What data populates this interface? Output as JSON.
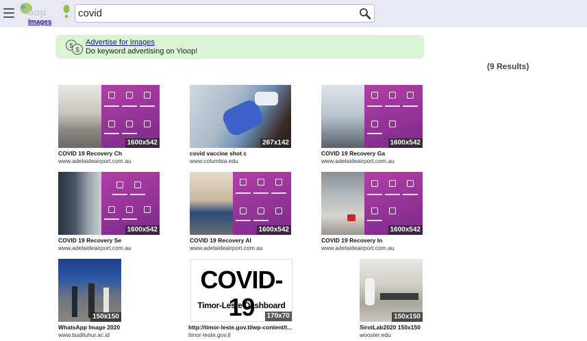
{
  "header": {
    "search_value": "covid",
    "logo_text": "Yioop!",
    "logo_link": "Images"
  },
  "ad": {
    "link": "Advertise for Images",
    "text": "Do keyword advertising on Yioop!"
  },
  "results_count": "(9 Results)",
  "colors": {
    "topbar": "#e9e9f6",
    "ad_bg": "#d9f5d4",
    "link": "#1a0dab",
    "purple": "#9b35a0"
  },
  "results": [
    {
      "title": "COVID 19 Recovery Ch",
      "domain": "www.adelaideairport.com.au",
      "size": "1600x542"
    },
    {
      "title": "covid vaccine shot c",
      "domain": "www.columbia.edu",
      "size": "267x142"
    },
    {
      "title": "COVID 19 Recovery Ga",
      "domain": "www.adelaideairport.com.au",
      "size": "1600x542"
    },
    {
      "title": "COVID 19 Recovery Se",
      "domain": "www.adelaideairport.com.au",
      "size": "1600x542"
    },
    {
      "title": "COVID 19 Recovery Al",
      "domain": "www.adelaideairport.com.au",
      "size": "1600x542"
    },
    {
      "title": "COVID 19 Recovery In",
      "domain": "www.adelaideairport.com.au",
      "size": "1600x542"
    },
    {
      "title": "WhatsApp Image 2020",
      "domain": "www.budiluhur.ac.id",
      "size": "150x150"
    },
    {
      "title": "http://timor-leste.gov.tl/wp-content/t...",
      "domain": "timor-leste.gov.tl",
      "size": "170x70",
      "image_text_1": "COVID-19",
      "image_text_2": "Timor-Leste Dashboard"
    },
    {
      "title": "SirotLab2020 150x150",
      "domain": "wooster.edu",
      "size": "150x150"
    }
  ]
}
